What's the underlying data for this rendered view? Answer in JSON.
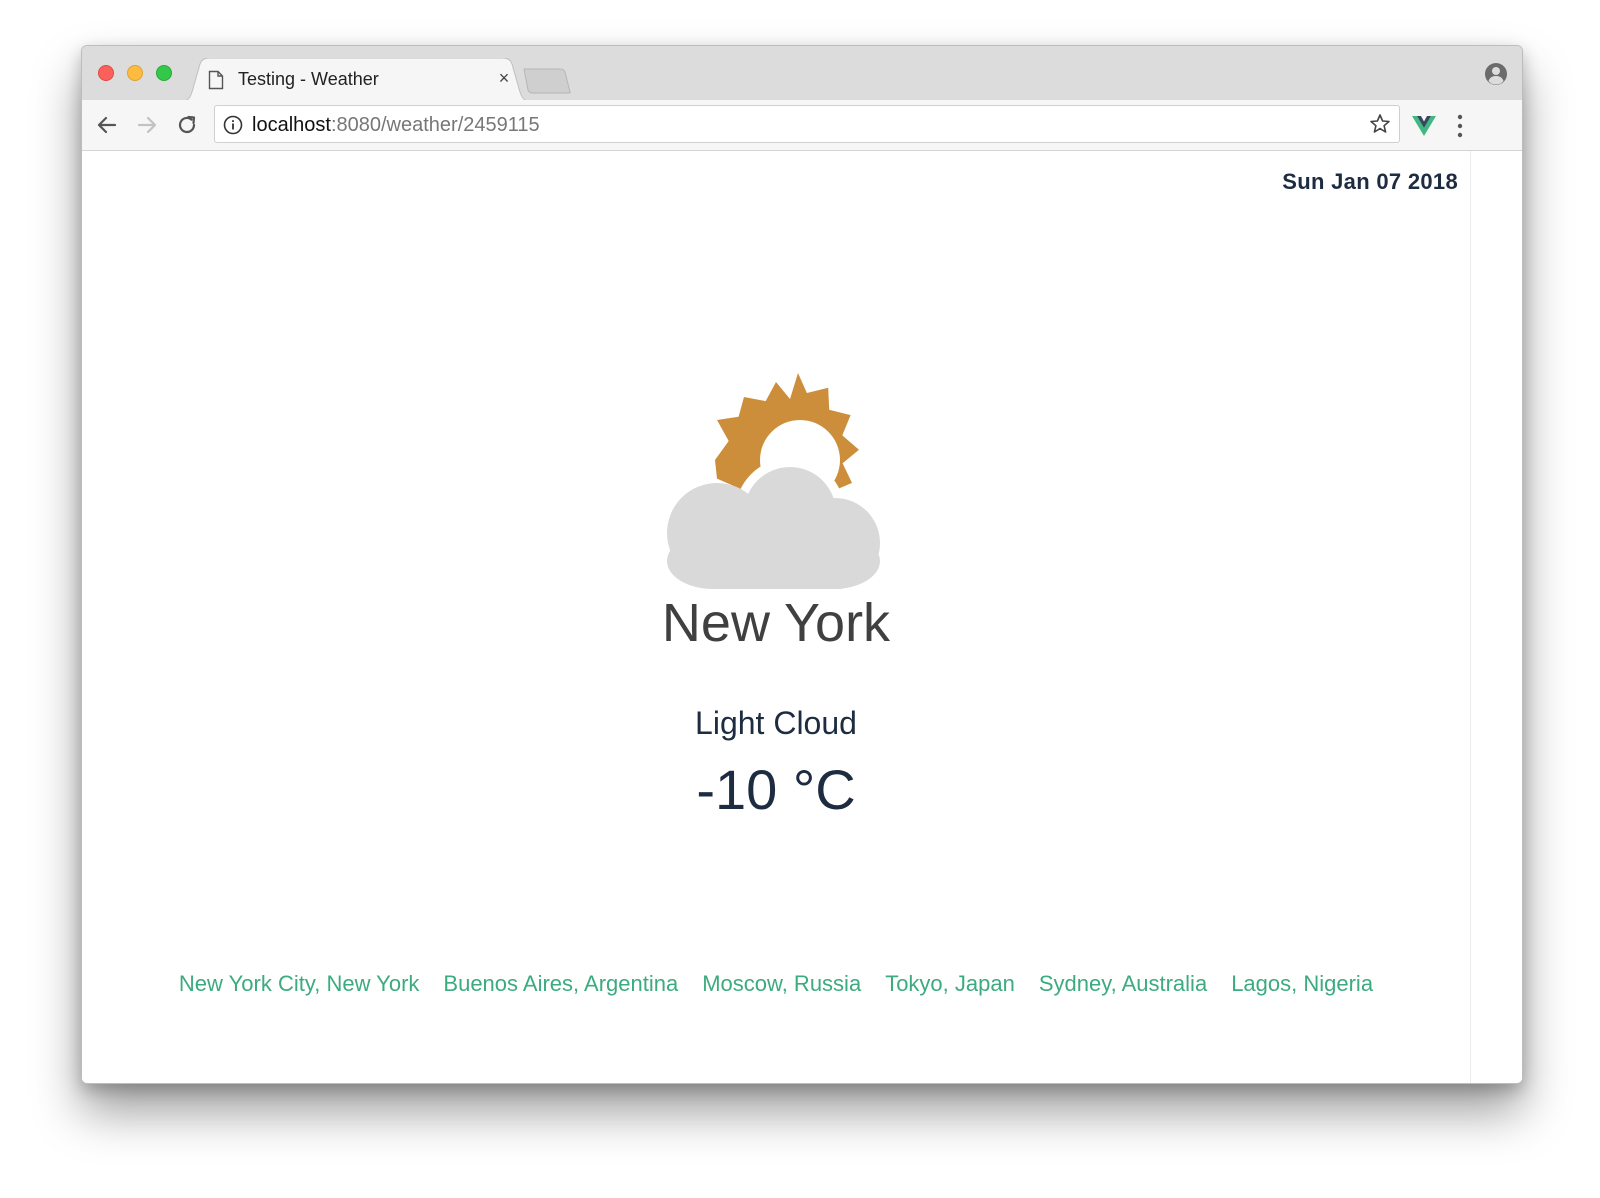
{
  "browser": {
    "tab_title": "Testing - Weather",
    "tab_close_glyph": "×",
    "url_host": "localhost",
    "url_path": ":8080/weather/2459115",
    "icons": {
      "tab": "document-icon",
      "back": "arrow-left-icon",
      "forward": "arrow-right-icon",
      "reload": "reload-icon",
      "info": "info-icon",
      "bookmark": "star-icon",
      "extension": "vue-devtools-icon",
      "menu": "kebab-menu-icon",
      "profile": "profile-icon"
    }
  },
  "page": {
    "date": "Sun Jan 07 2018",
    "city": "New York",
    "condition": "Light Cloud",
    "temperature": "-10 °C",
    "weather_icon": "light-cloud-icon",
    "cities": [
      "New York City, New York",
      "Buenos Aires, Argentina",
      "Moscow, Russia",
      "Tokyo, Japan",
      "Sydney, Australia",
      "Lagos, Nigeria"
    ]
  },
  "colors": {
    "link": "#3cab80",
    "text_dark": "#1d2c40",
    "city_text": "#404040",
    "sun": "#cc8e3b",
    "cloud": "#d9d9d9",
    "vue_green": "#41b883",
    "vue_dark": "#35495e"
  }
}
